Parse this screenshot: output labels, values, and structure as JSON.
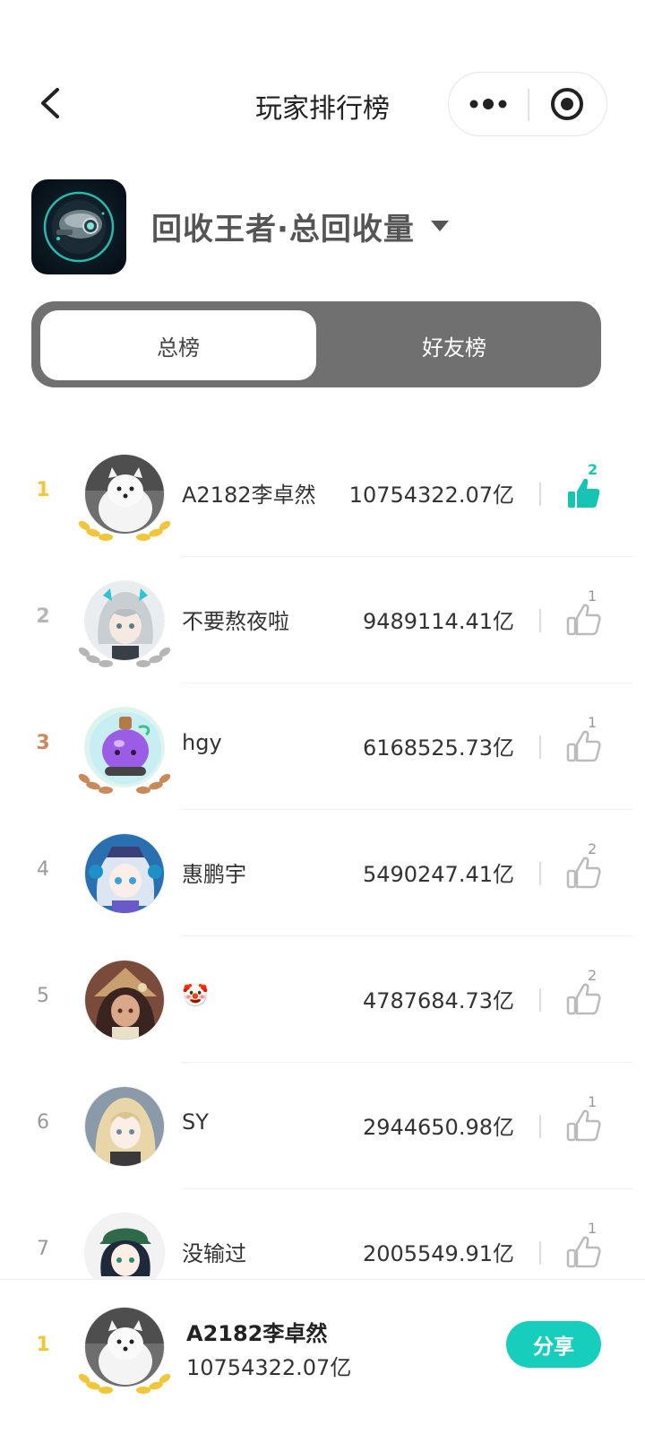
{
  "nav": {
    "title": "玩家排行榜"
  },
  "game": {
    "title": "回收王者·总回收量"
  },
  "tabs": [
    {
      "label": "总榜",
      "active": true
    },
    {
      "label": "好友榜",
      "active": false
    }
  ],
  "colors": {
    "accent": "#17cdbc",
    "gold": "#f2c63a",
    "silver": "#b6b6b6",
    "bronze": "#c98a5b",
    "tab_bg": "#707070"
  },
  "rows": [
    {
      "rank": "1",
      "name": "A2182李卓然",
      "score": "10754322.07亿",
      "likes": "2",
      "liked": true,
      "avatar": "white-dog-avatar"
    },
    {
      "rank": "2",
      "name": "不要熬夜啦",
      "score": "9489114.41亿",
      "likes": "1",
      "liked": false,
      "avatar": "silver-hair-girl-avatar"
    },
    {
      "rank": "3",
      "name": "hgy",
      "score": "6168525.73亿",
      "likes": "1",
      "liked": false,
      "avatar": "purple-potion-avatar"
    },
    {
      "rank": "4",
      "name": "惠鹏宇",
      "score": "5490247.41亿",
      "likes": "2",
      "liked": false,
      "avatar": "blue-anime-girl-avatar"
    },
    {
      "rank": "5",
      "name": "🤡",
      "score": "4787684.73亿",
      "likes": "2",
      "liked": false,
      "avatar": "tribal-anime-girl-avatar"
    },
    {
      "rank": "6",
      "name": "SY",
      "score": "2944650.98亿",
      "likes": "1",
      "liked": false,
      "avatar": "blonde-anime-girl-avatar"
    },
    {
      "rank": "7",
      "name": "没输过",
      "score": "2005549.91亿",
      "likes": "1",
      "liked": false,
      "avatar": "green-hat-boy-avatar"
    }
  ],
  "me": {
    "rank": "1",
    "name": "A2182李卓然",
    "score": "10754322.07亿",
    "share_label": "分享"
  }
}
